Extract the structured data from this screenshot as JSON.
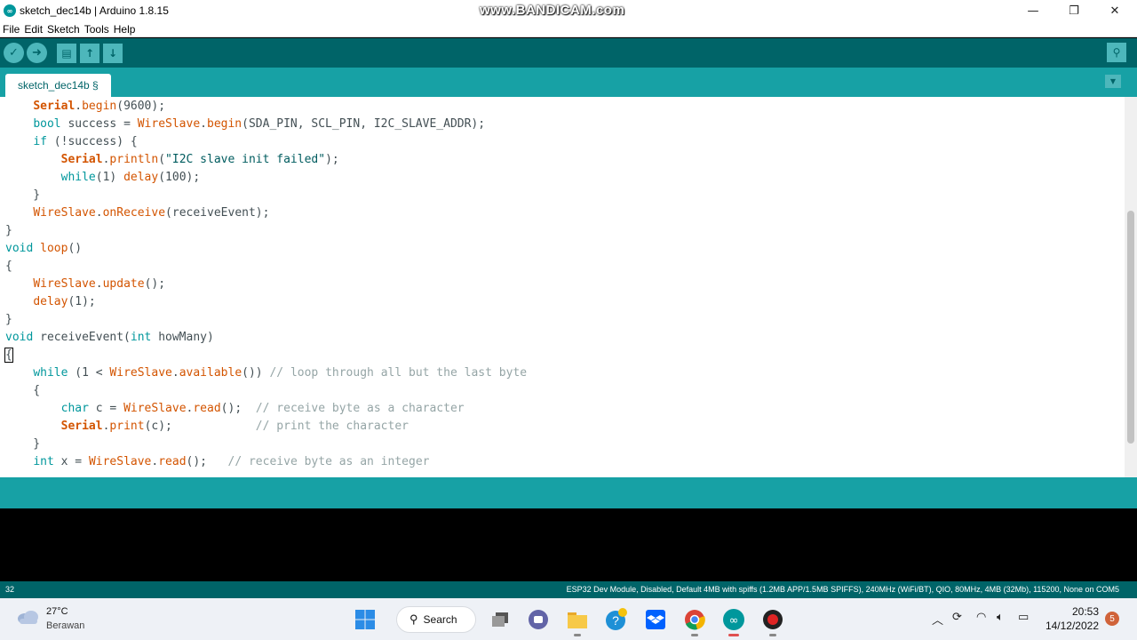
{
  "window": {
    "title": "sketch_dec14b | Arduino 1.8.15",
    "watermark": "www.BANDICAM.com",
    "minimize": "—",
    "maximize": "❐",
    "close": "✕"
  },
  "menu": [
    "File",
    "Edit",
    "Sketch",
    "Tools",
    "Help"
  ],
  "toolbar": {
    "verify": "✓",
    "upload": "➜",
    "new": "▤",
    "open": "↑",
    "save": "↓",
    "serial_monitor": "⚲"
  },
  "tab": {
    "label": "sketch_dec14b §",
    "menu": "▼"
  },
  "code_lines": [
    "    Serial.begin(9600);",
    "    bool success = WireSlave.begin(SDA_PIN, SCL_PIN, I2C_SLAVE_ADDR);",
    "    if (!success) {",
    "        Serial.println(\"I2C slave init failed\");",
    "        while(1) delay(100);",
    "    }",
    "    WireSlave.onReceive(receiveEvent);",
    "}",
    "void loop()",
    "{",
    "    WireSlave.update();",
    "    delay(1);",
    "}",
    "void receiveEvent(int howMany)",
    "{",
    "    while (1 < WireSlave.available()) // loop through all but the last byte",
    "    {",
    "        char c = WireSlave.read();  // receive byte as a character",
    "        Serial.print(c);            // print the character",
    "    }",
    "    int x = WireSlave.read();   // receive byte as an integer"
  ],
  "status": {
    "line_number": "32",
    "board": "ESP32 Dev Module, Disabled, Default 4MB with spiffs (1.2MB APP/1.5MB SPIFFS), 240MHz (WiFi/BT), QIO, 80MHz, 4MB (32Mb), 115200, None on COM5"
  },
  "taskbar": {
    "weather_temp": "27°C",
    "weather_desc": "Berawan",
    "search_label": "Search",
    "time": "20:53",
    "date": "14/12/2022",
    "notifications": "5"
  },
  "colors": {
    "toolbar": "#006468",
    "tabbar": "#17a1a5",
    "keyword": "#00979c",
    "function": "#d35400"
  }
}
